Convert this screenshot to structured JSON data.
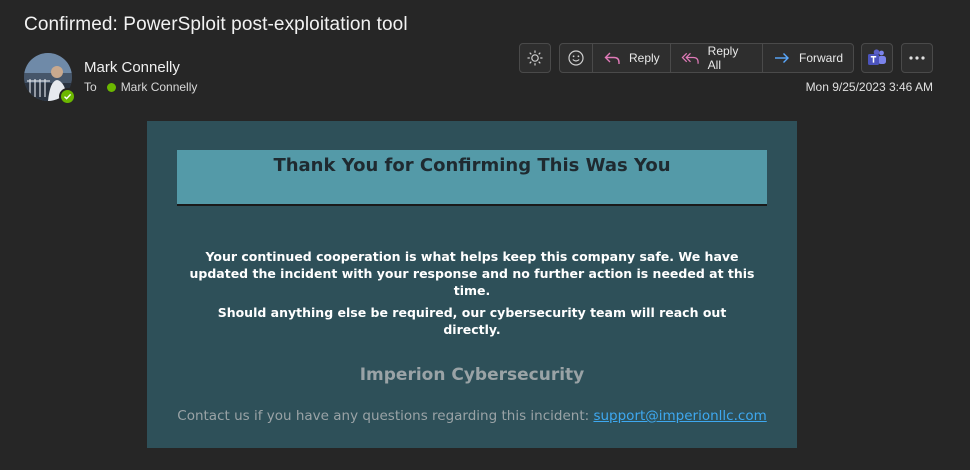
{
  "email": {
    "subject": "Confirmed: PowerSploit post-exploitation tool",
    "sender_name": "Mark Connelly",
    "to_label": "To",
    "recipient_name": "Mark Connelly",
    "timestamp": "Mon 9/25/2023 3:46 AM"
  },
  "toolbar": {
    "reply_label": "Reply",
    "reply_all_label": "Reply All",
    "forward_label": "Forward"
  },
  "body": {
    "banner_title": "Thank You for Confirming This Was You",
    "paragraph_1": "Your continued cooperation is what helps keep this company safe. We have updated the incident with your response and no further action is needed at this time.",
    "paragraph_2": "Should anything else be required, our cybersecurity team will reach out directly.",
    "company_name": "Imperion Cybersecurity",
    "contact_text": "Contact us if you have any questions regarding this incident:",
    "contact_email": "support@imperionllc.com"
  },
  "icons": {
    "theme": "sun-icon",
    "emoji": "smiley-icon",
    "reply": "reply-arrow-icon",
    "reply_all": "reply-all-arrow-icon",
    "forward": "forward-arrow-icon",
    "teams": "teams-icon",
    "more": "more-icon",
    "presence": "available-check-icon"
  },
  "colors": {
    "background": "#262626",
    "card": "#2e5059",
    "banner": "#549aa8",
    "link": "#3ea8f0",
    "presence": "#6bb700",
    "reply_icon": "#e07ab8",
    "forward_icon": "#5aa9ff",
    "teams": "#5b5fc7"
  }
}
